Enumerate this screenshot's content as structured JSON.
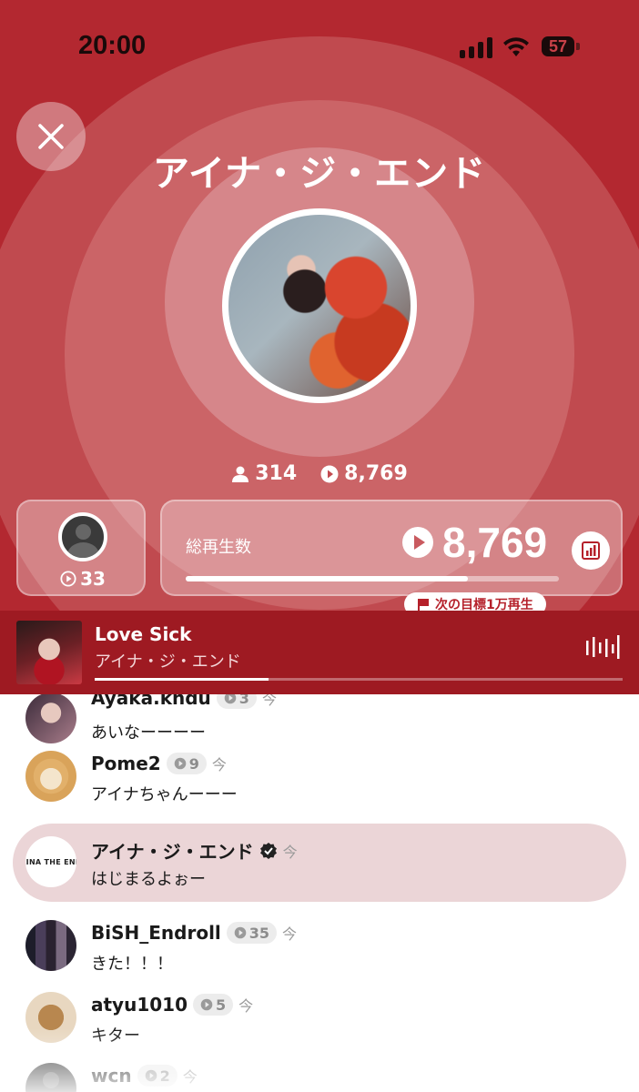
{
  "status_bar": {
    "time": "20:00",
    "battery": "57"
  },
  "header": {
    "artist_name": "アイナ・ジ・エンド"
  },
  "stats": {
    "listeners": "314",
    "plays": "8,769"
  },
  "top_listener": {
    "play_count": "33"
  },
  "total_plays_card": {
    "label": "総再生数",
    "value": "8,769",
    "progress_fraction": 0.757,
    "goal_label": "次の目標1万再生"
  },
  "now_playing": {
    "song": "Love Sick",
    "artist": "アイナ・ジ・エンド",
    "progress_fraction": 0.33
  },
  "comments": [
    {
      "user": "Ayaka.kndu",
      "badge": "3",
      "time": "今",
      "text": "あいなーーーー"
    },
    {
      "user": "Pome2",
      "badge": "9",
      "time": "今",
      "text": "アイナちゃんーーー"
    },
    {
      "user": "アイナ・ジ・エンド",
      "verified": true,
      "time": "今",
      "text": "はじまるよぉー",
      "avatar_text": "AINA THE END"
    },
    {
      "user": "BiSH_Endroll",
      "badge": "35",
      "time": "今",
      "text": "きた！！！"
    },
    {
      "user": "atyu1010",
      "badge": "5",
      "time": "今",
      "text": "キター"
    },
    {
      "user": "wcn",
      "badge": "2",
      "time": "今",
      "text": ""
    }
  ],
  "colors": {
    "primary_red": "#a71c24",
    "player_red": "#9e1a22",
    "highlight_pink": "#ebd5d7"
  }
}
